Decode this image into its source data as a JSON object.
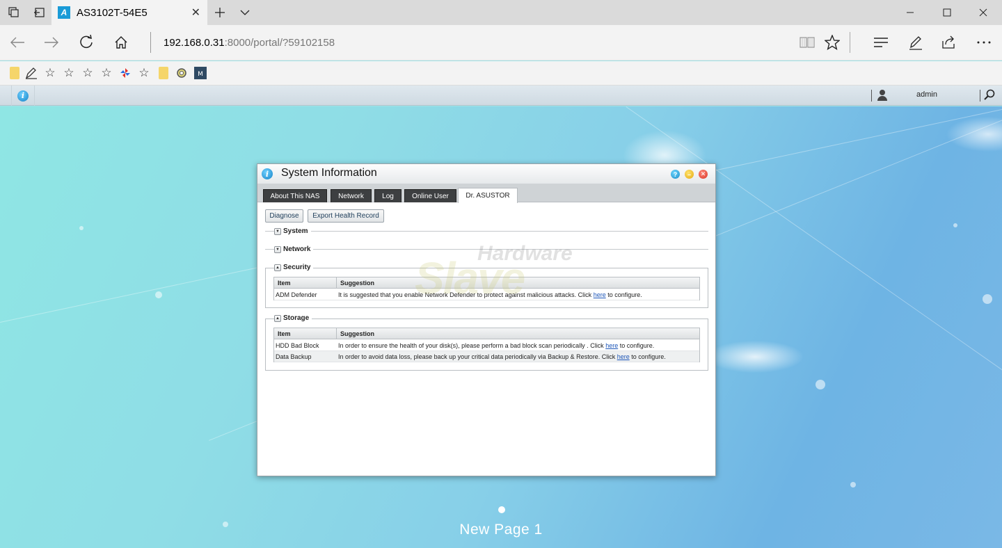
{
  "browser": {
    "tab_title": "AS3102T-54E5",
    "tab_favicon": "A",
    "url_host": "192.168.0.31",
    "url_rest": ":8000/portal/?59102158",
    "icons": {
      "tab_manager": "tab-manager-icon",
      "set_aside": "set-aside-icon",
      "close": "close-icon",
      "new_tab": "plus-icon",
      "tab_list": "chevron-down-icon",
      "minimize": "minimize-icon",
      "maximize": "maximize-icon",
      "window_close": "close-icon",
      "back": "back-arrow-icon",
      "forward": "forward-arrow-icon",
      "refresh": "refresh-icon",
      "home": "home-icon",
      "reading_view": "book-icon",
      "favorite": "star-icon",
      "hub": "hub-icon",
      "notes": "pen-icon",
      "share": "share-icon",
      "more": "more-icon"
    }
  },
  "favorites": [
    "folder",
    "pen",
    "star",
    "star",
    "star",
    "star",
    "pinwheel",
    "star",
    "folder",
    "gear",
    "m-app"
  ],
  "nas": {
    "user": "admin"
  },
  "window": {
    "title": "System Information",
    "tabs": [
      {
        "label": "About This NAS",
        "active": false
      },
      {
        "label": "Network",
        "active": false
      },
      {
        "label": "Log",
        "active": false
      },
      {
        "label": "Online User",
        "active": false
      },
      {
        "label": "Dr. ASUSTOR",
        "active": true
      }
    ],
    "buttons": {
      "diagnose": "Diagnose",
      "export": "Export Health Record"
    },
    "sections": {
      "system": "System",
      "network": "Network",
      "security": "Security",
      "storage": "Storage"
    },
    "columns": {
      "item": "Item",
      "suggestion": "Suggestion"
    },
    "security_rows": [
      {
        "item": "ADM Defender",
        "pre": "It is suggested that you enable Network Defender to protect against malicious attacks. Click ",
        "link": "here",
        "post": " to configure."
      }
    ],
    "storage_rows": [
      {
        "item": "HDD Bad Block",
        "pre": "In order to ensure the health of your disk(s), please perform a bad block scan periodically . Click ",
        "link": "here",
        "post": " to configure."
      },
      {
        "item": "Data Backup",
        "pre": "In order to avoid data loss, please back up your critical data periodically via Backup & Restore. Click ",
        "link": "here",
        "post": " to configure."
      }
    ]
  },
  "desktop": {
    "page_label": "New Page 1"
  },
  "watermark": {
    "top": "Hardware",
    "bottom": "Slave"
  }
}
